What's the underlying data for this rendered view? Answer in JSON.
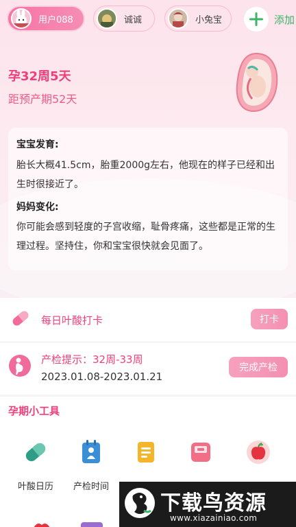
{
  "profiles": [
    {
      "label": "用户088",
      "active": true
    },
    {
      "label": "诚诚",
      "active": false
    },
    {
      "label": "小兔宝",
      "active": false
    }
  ],
  "add_label": "添加",
  "pregnancy": {
    "week_label": "孕32周5天",
    "due_label": "距预产期52天"
  },
  "development": {
    "baby_title": "宝宝发育:",
    "baby_text": "胎长大概41.5cm，胎重2000g左右，他现在的样子已经和出生时很接近了。",
    "mom_title": "妈妈变化:",
    "mom_text": "你可能会感到轻度的子宫收缩，耻骨疼痛，这些都是正常的生理过程。坚持住，你和宝宝很快就会见面了。"
  },
  "folic_acid": {
    "label": "每日叶酸打卡",
    "button": "打卡"
  },
  "checkup": {
    "label": "产检提示：32周-33周",
    "dates": "2023.01.08-2023.01.21",
    "button": "完成产检"
  },
  "tools": {
    "title": "孕期小工具",
    "items": [
      {
        "label": "叶酸日历",
        "icon": "capsule-icon"
      },
      {
        "label": "产检时间",
        "icon": "calendar-baby-icon"
      },
      {
        "label": "",
        "icon": "document-icon"
      },
      {
        "label": "",
        "icon": "scale-icon"
      },
      {
        "label": "",
        "icon": "apple-icon"
      }
    ]
  },
  "watermark": {
    "main": "下载鸟资源",
    "sub": "www.xiazainiao.com"
  },
  "colors": {
    "accent": "#ef3f7a",
    "accent_soft": "#f490b2",
    "add_green": "#3cb36a"
  }
}
